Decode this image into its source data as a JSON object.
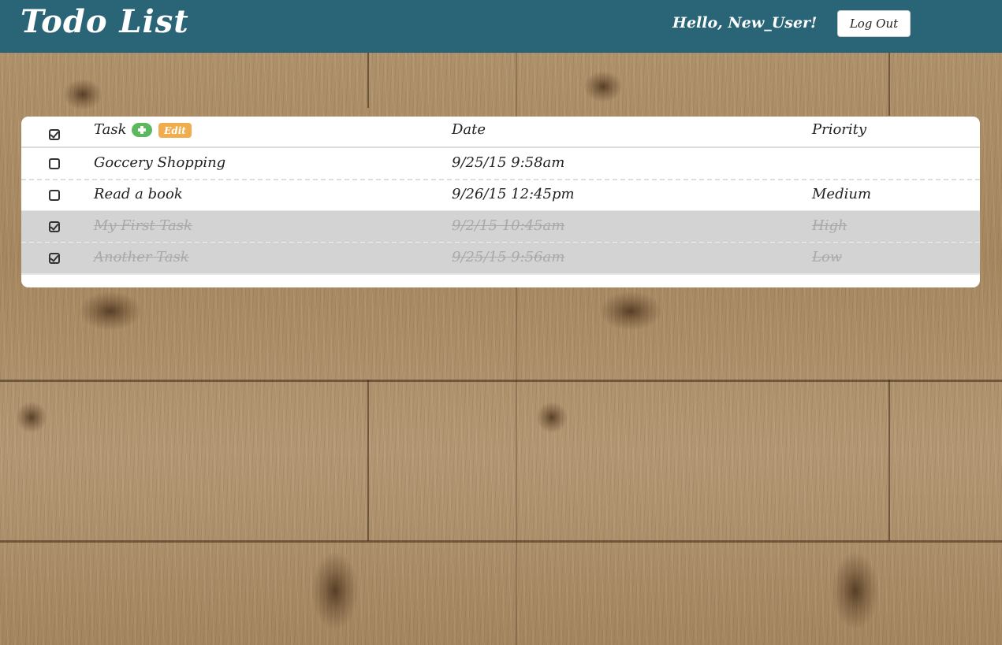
{
  "header": {
    "brand": "Todo List",
    "greeting": "Hello, New_User!",
    "logout_label": "Log Out"
  },
  "table": {
    "columns": {
      "task": "Task",
      "date": "Date",
      "priority": "Priority"
    },
    "edit_label": "Edit",
    "rows": [
      {
        "task": "Goccery Shopping",
        "date": "9/25/15 9:58am",
        "priority": "",
        "completed": false
      },
      {
        "task": "Read a book",
        "date": "9/26/15 12:45pm",
        "priority": "Medium",
        "completed": false
      },
      {
        "task": "My First Task",
        "date": "9/2/15 10:45am",
        "priority": "High",
        "completed": true
      },
      {
        "task": "Another Task",
        "date": "9/25/15 9:56am",
        "priority": "Low",
        "completed": true
      }
    ]
  },
  "colors": {
    "topbar": "#2a6577",
    "completed_row": "#d3d3d3",
    "add_button": "#5cb85c",
    "edit_button": "#f0ad4e"
  },
  "icons": {
    "add": "plus-circle-icon",
    "checkbox_checked": "check-square-icon",
    "checkbox_empty": "square-icon"
  }
}
